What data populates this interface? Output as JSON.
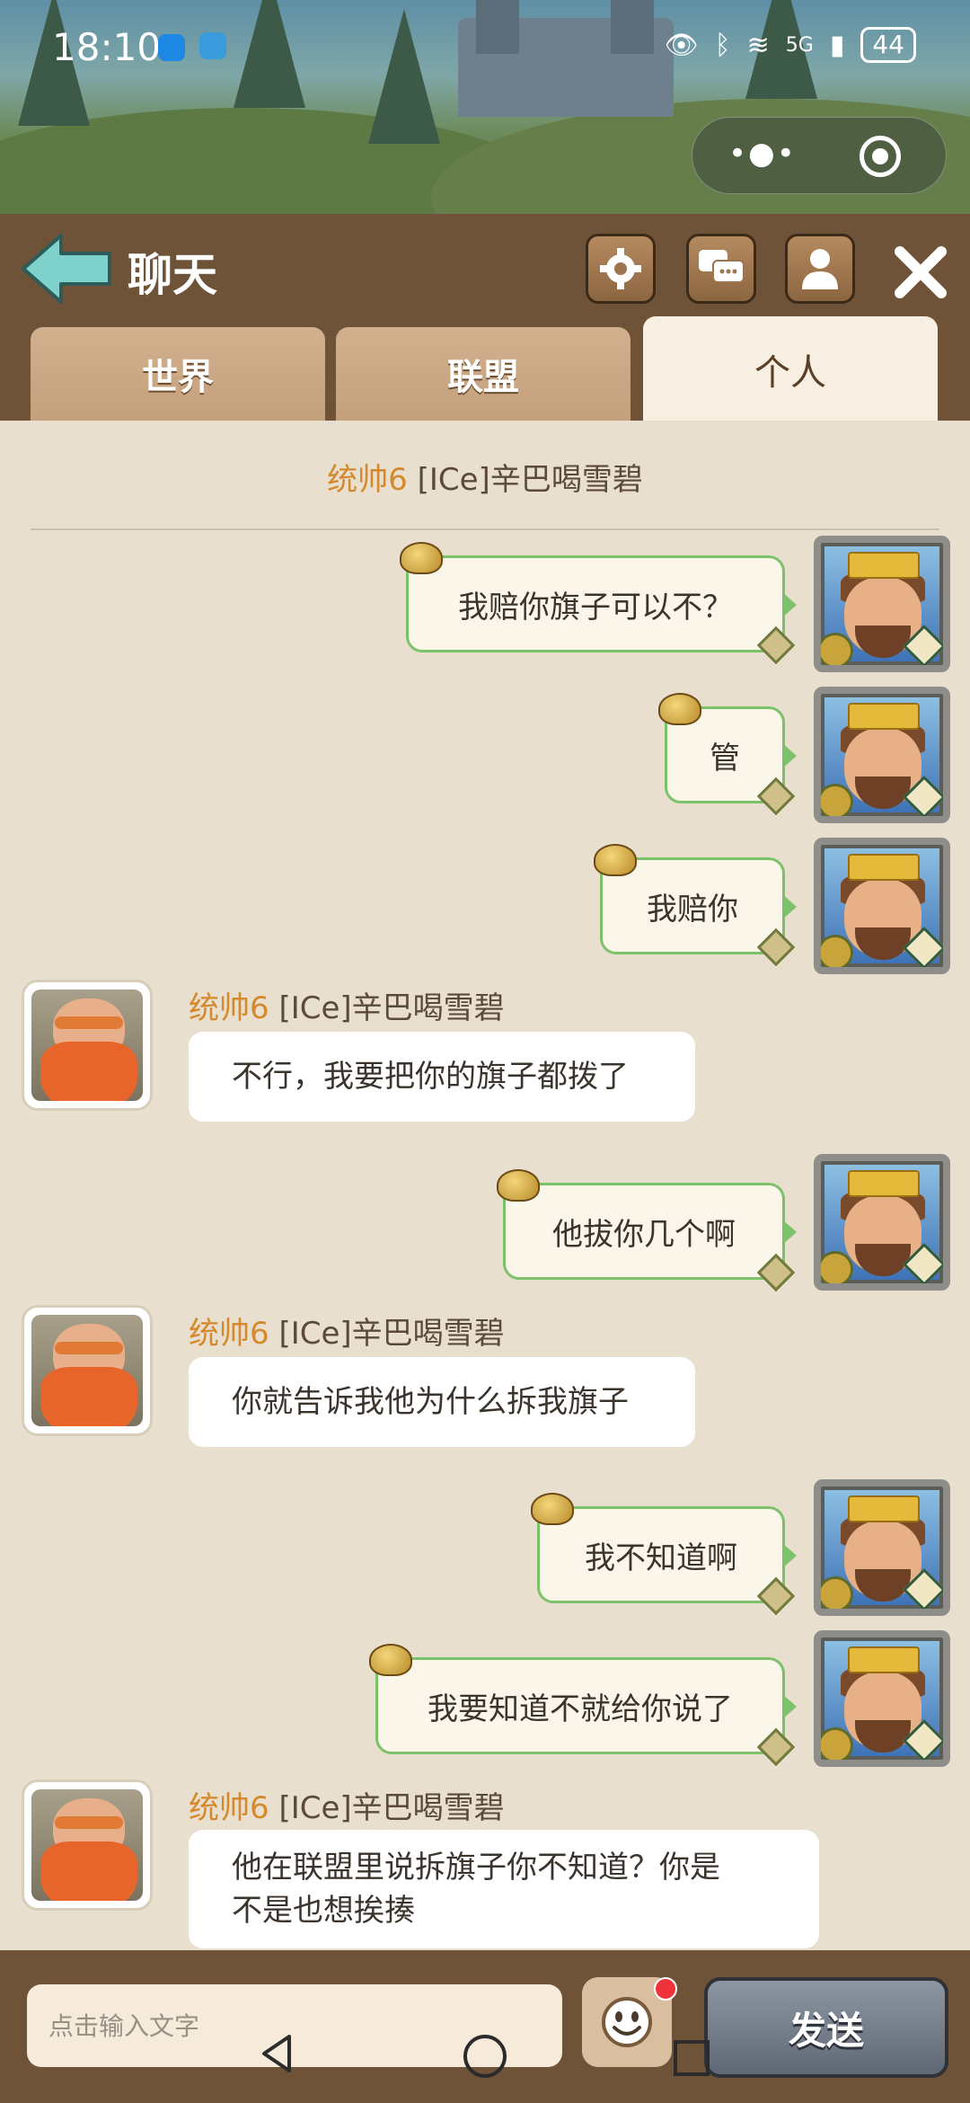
{
  "status_bar": {
    "time": "18:10",
    "network": "5G",
    "battery": "44"
  },
  "header": {
    "title": "聊天",
    "tabs": [
      {
        "label": "世界",
        "active": false
      },
      {
        "label": "联盟",
        "active": false
      },
      {
        "label": "个人",
        "active": true
      }
    ]
  },
  "chat": {
    "header_rank": "统帅6",
    "header_name": "[ICe]辛巴喝雪碧",
    "messages": [
      {
        "side": "right",
        "text": "我赔你旗子可以不？"
      },
      {
        "side": "right",
        "text": "管"
      },
      {
        "side": "right",
        "text": "我赔你"
      },
      {
        "side": "left",
        "rank": "统帅6",
        "sender": "[ICe]辛巴喝雪碧",
        "text": "不行，我要把你的旗子都拨了"
      },
      {
        "side": "right",
        "text": "他拔你几个啊"
      },
      {
        "side": "left",
        "rank": "统帅6",
        "sender": "[ICe]辛巴喝雪碧",
        "text": "你就告诉我他为什么拆我旗子"
      },
      {
        "side": "right",
        "text": "我不知道啊"
      },
      {
        "side": "right",
        "text": "我要知道不就给你说了"
      },
      {
        "side": "left",
        "rank": "统帅6",
        "sender": "[ICe]辛巴喝雪碧",
        "text_line1": "他在联盟里说拆旗子你不知道？你是",
        "text_line2": "不是也想挨揍"
      }
    ]
  },
  "input_bar": {
    "placeholder": "点击输入文字",
    "send_label": "发送"
  },
  "colors": {
    "header_brown": "#6e5338",
    "chat_bg": "#e9dfcf",
    "bubble_border_green": "#7cc26a",
    "rank_orange": "#d48a2c"
  }
}
